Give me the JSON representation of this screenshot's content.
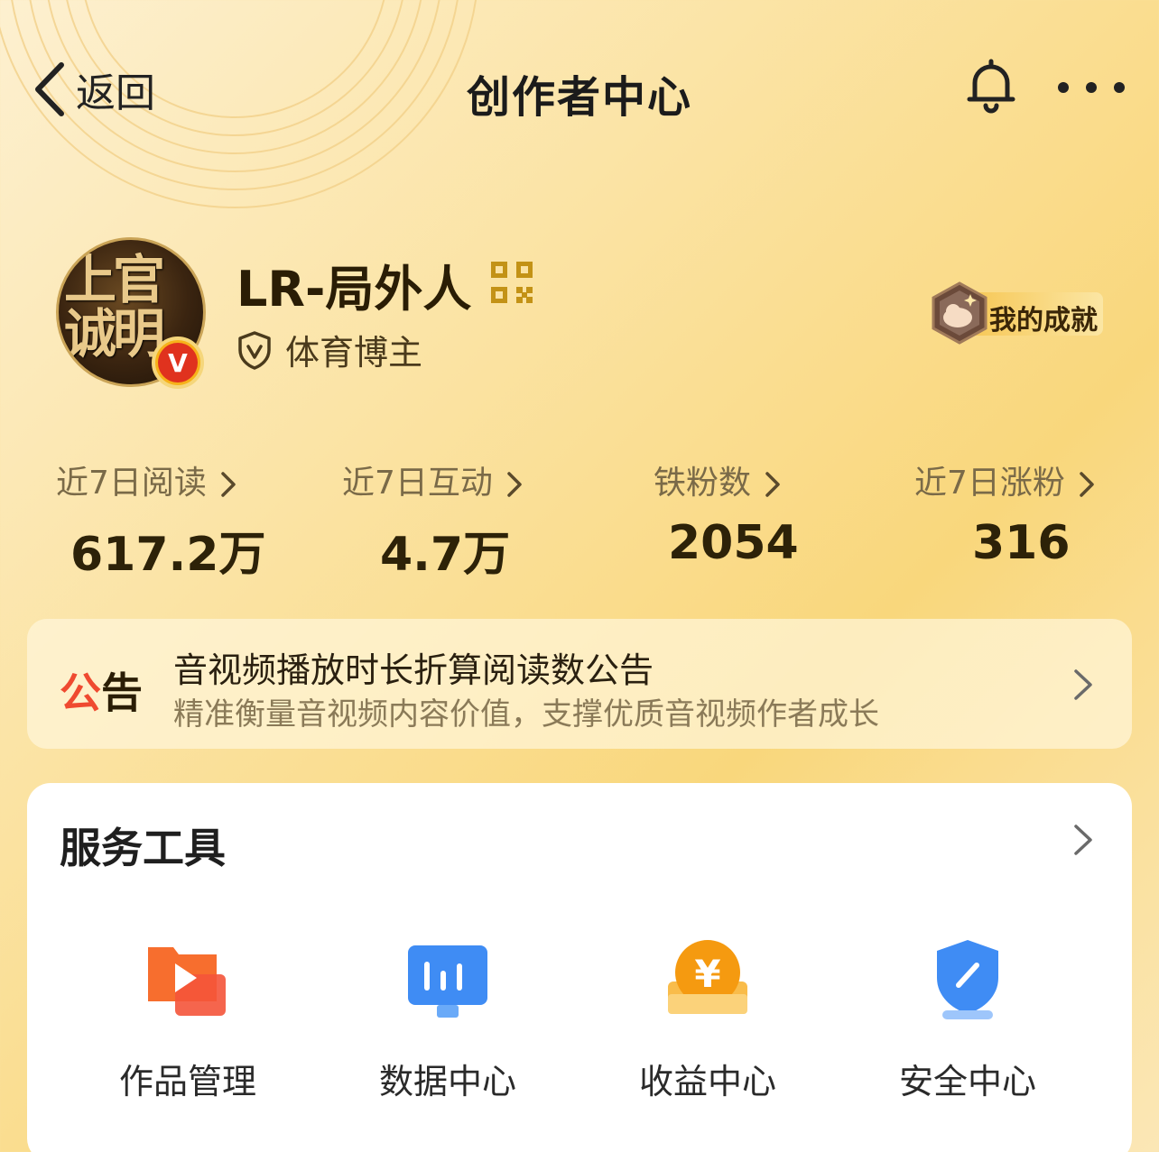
{
  "header": {
    "back_label": "返回",
    "title": "创作者中心",
    "back_icon": "chevron-left-icon",
    "bell_icon": "bell-icon",
    "more_icon": "more-dots-icon"
  },
  "profile": {
    "avatar_text": "上官诚明",
    "verified_badge": "V",
    "username": "LR-局外人",
    "qr_icon": "qr-code-icon",
    "role_icon": "verified-shield-icon",
    "role": "体育博主",
    "achievement_label": "我的成就",
    "achievement_icon": "achievement-badge-icon"
  },
  "stats": [
    {
      "label": "近7日阅读",
      "value": "617.2万"
    },
    {
      "label": "近7日互动",
      "value": "4.7万"
    },
    {
      "label": "铁粉数",
      "value": "2054"
    },
    {
      "label": "近7日涨粉",
      "value": "316"
    }
  ],
  "notice": {
    "tag_part1": "公",
    "tag_part2": "告",
    "title": "音视频播放时长折算阅读数公告",
    "subtitle": "精准衡量音视频内容价值，支撑优质音视频作者成长"
  },
  "tools": {
    "title": "服务工具",
    "items": [
      {
        "label": "作品管理",
        "icon": "works-folder-icon"
      },
      {
        "label": "数据中心",
        "icon": "data-chart-icon"
      },
      {
        "label": "收益中心",
        "icon": "yuan-coin-icon"
      },
      {
        "label": "安全中心",
        "icon": "security-shield-icon"
      }
    ]
  },
  "colors": {
    "accent_red": "#ef4a30",
    "verified_red": "#e0321e",
    "gold": "#f7b21a",
    "blue": "#3f8cf4",
    "orange": "#f59a10"
  }
}
